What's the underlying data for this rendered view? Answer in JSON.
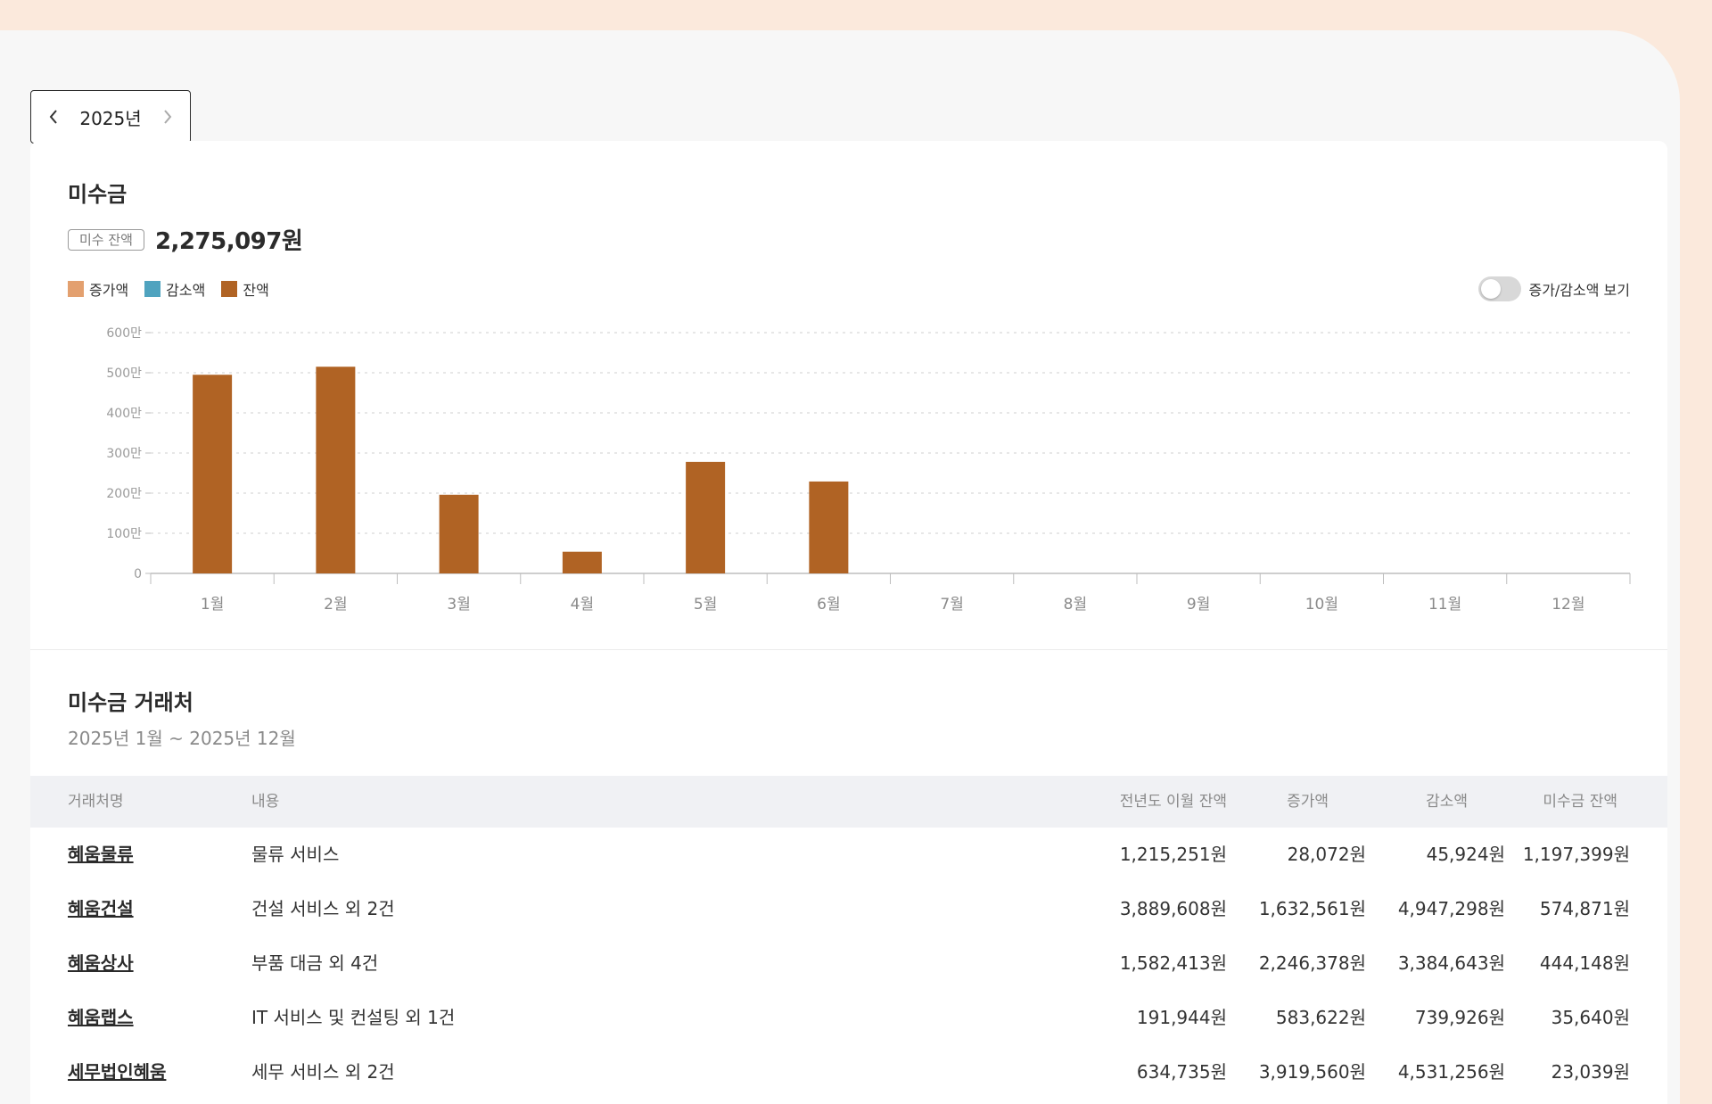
{
  "year_nav": {
    "year": "2025년"
  },
  "summary": {
    "title": "미수금",
    "balance_badge": "미수 잔액",
    "balance_amount": "2,275,097원"
  },
  "legend": [
    {
      "label": "증가액",
      "color": "#e3a06f"
    },
    {
      "label": "감소액",
      "color": "#4fa3bf"
    },
    {
      "label": "잔액",
      "color": "#b06324"
    }
  ],
  "toggle": {
    "label": "증가/감소액 보기",
    "on": false
  },
  "chart_data": {
    "type": "bar",
    "categories": [
      "1월",
      "2월",
      "3월",
      "4월",
      "5월",
      "6월",
      "7월",
      "8월",
      "9월",
      "10월",
      "11월",
      "12월"
    ],
    "series": [
      {
        "name": "잔액",
        "values": [
          4950000,
          5150000,
          1960000,
          540000,
          2780000,
          2290000,
          null,
          null,
          null,
          null,
          null,
          null
        ],
        "color": "#b06324"
      }
    ],
    "ylim": [
      0,
      6000000
    ],
    "yticks": [
      0,
      1000000,
      2000000,
      3000000,
      4000000,
      5000000,
      6000000
    ],
    "yticklabels": [
      "0",
      "100만",
      "200만",
      "300만",
      "400만",
      "500만",
      "600만"
    ],
    "grid": true,
    "legend_position": "top-left"
  },
  "table": {
    "title": "미수금 거래처",
    "period": "2025년 1월 ~ 2025년 12월",
    "headers": {
      "client": "거래처명",
      "content": "내용",
      "prev_balance": "전년도 이월 잔액",
      "increase": "증가액",
      "decrease": "감소액",
      "balance": "미수금 잔액"
    },
    "rows": [
      {
        "client": "혜움물류",
        "content": "물류 서비스",
        "prev_balance": "1,215,251원",
        "increase": "28,072원",
        "decrease": "45,924원",
        "balance": "1,197,399원"
      },
      {
        "client": "혜움건설",
        "content": "건설 서비스 외 2건",
        "prev_balance": "3,889,608원",
        "increase": "1,632,561원",
        "decrease": "4,947,298원",
        "balance": "574,871원"
      },
      {
        "client": "혜움상사",
        "content": "부품 대금 외 4건",
        "prev_balance": "1,582,413원",
        "increase": "2,246,378원",
        "decrease": "3,384,643원",
        "balance": "444,148원"
      },
      {
        "client": "혜움랩스",
        "content": "IT 서비스 및 컨설팅 외 1건",
        "prev_balance": "191,944원",
        "increase": "583,622원",
        "decrease": "739,926원",
        "balance": "35,640원"
      },
      {
        "client": "세무법인혜움",
        "content": "세무 서비스 외 2건",
        "prev_balance": "634,735원",
        "increase": "3,919,560원",
        "decrease": "4,531,256원",
        "balance": "23,039원"
      }
    ]
  }
}
